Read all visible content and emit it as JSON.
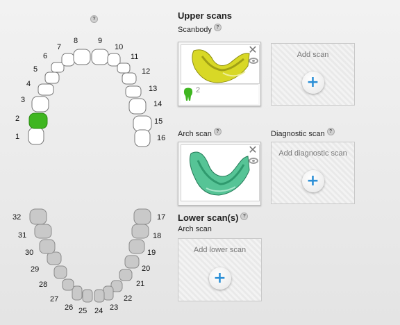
{
  "help_glyph": "?",
  "upper": {
    "title": "Upper scans",
    "scanbody_label": "Scanbody",
    "scanbody_tooth_count": "2",
    "add_scan_label": "Add scan",
    "arch_label": "Arch scan",
    "diagnostic_label": "Diagnostic scan",
    "add_diagnostic_label": "Add diagnostic scan"
  },
  "lower": {
    "title": "Lower scan(s)",
    "arch_label": "Arch scan",
    "add_lower_label": "Add lower scan"
  },
  "buttons": {
    "plus_glyph": "+",
    "close_glyph": "✕"
  },
  "teeth": {
    "upper_numbers": [
      "1",
      "2",
      "3",
      "4",
      "5",
      "6",
      "7",
      "8",
      "9",
      "10",
      "11",
      "12",
      "13",
      "14",
      "15",
      "16"
    ],
    "lower_numbers": [
      "17",
      "18",
      "19",
      "20",
      "21",
      "22",
      "23",
      "24",
      "25",
      "26",
      "27",
      "28",
      "29",
      "30",
      "31",
      "32"
    ],
    "selected": "2"
  },
  "colors": {
    "tooth_selected": "#3fb620",
    "tooth_lower": "#c9c9c9",
    "scanbody_model": "#d8d826",
    "arch_model": "#56c496",
    "plus_blue": "#2c8fd6"
  }
}
